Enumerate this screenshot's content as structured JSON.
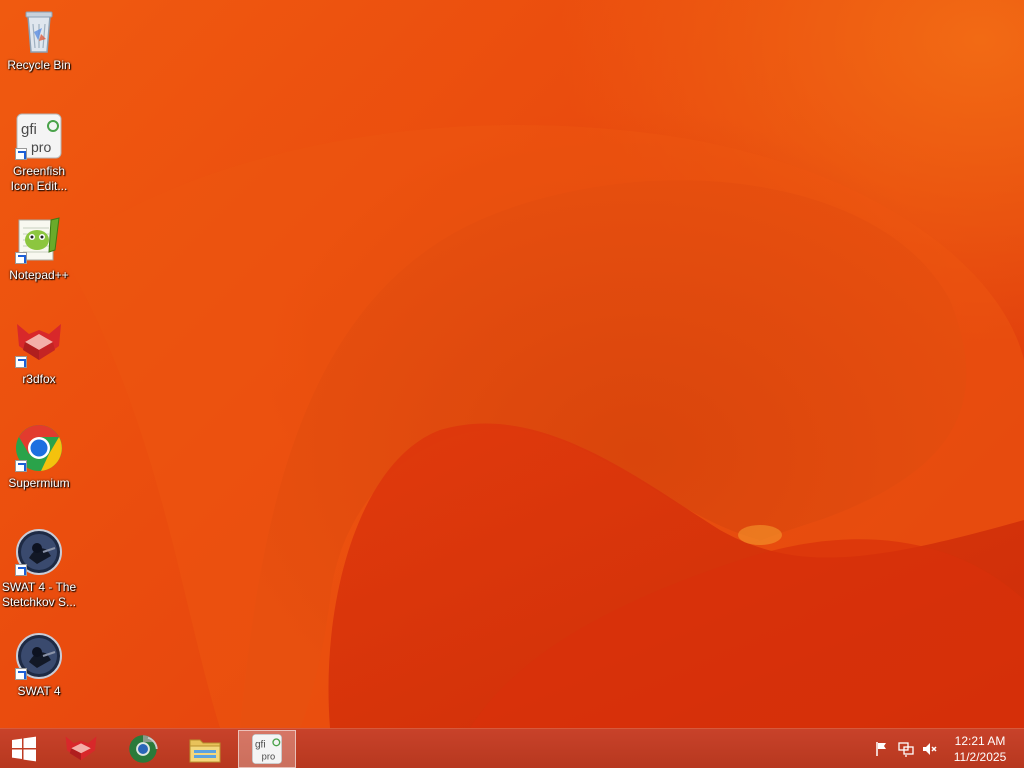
{
  "desktop": {
    "icons": [
      {
        "label": "Recycle Bin"
      },
      {
        "label": "Greenfish Icon Edit..."
      },
      {
        "label": "Notepad++"
      },
      {
        "label": "r3dfox"
      },
      {
        "label": "Supermium"
      },
      {
        "label": "SWAT 4 - The Stetchkov S..."
      },
      {
        "label": "SWAT 4"
      }
    ]
  },
  "taskbar": {
    "pinned": [
      {
        "icon": "r3dfox-icon"
      },
      {
        "icon": "supermium-icon"
      },
      {
        "icon": "file-explorer-icon"
      },
      {
        "icon": "greenfish-icon",
        "active": true
      }
    ],
    "tray": [
      "action-center-flag-icon",
      "network-icon",
      "volume-muted-icon"
    ],
    "clock": {
      "time": "12:21 AM",
      "date": "11/2/2025"
    }
  },
  "colors": {
    "wallpaper_accent": "#e84a12",
    "taskbar": "#c0402a"
  }
}
